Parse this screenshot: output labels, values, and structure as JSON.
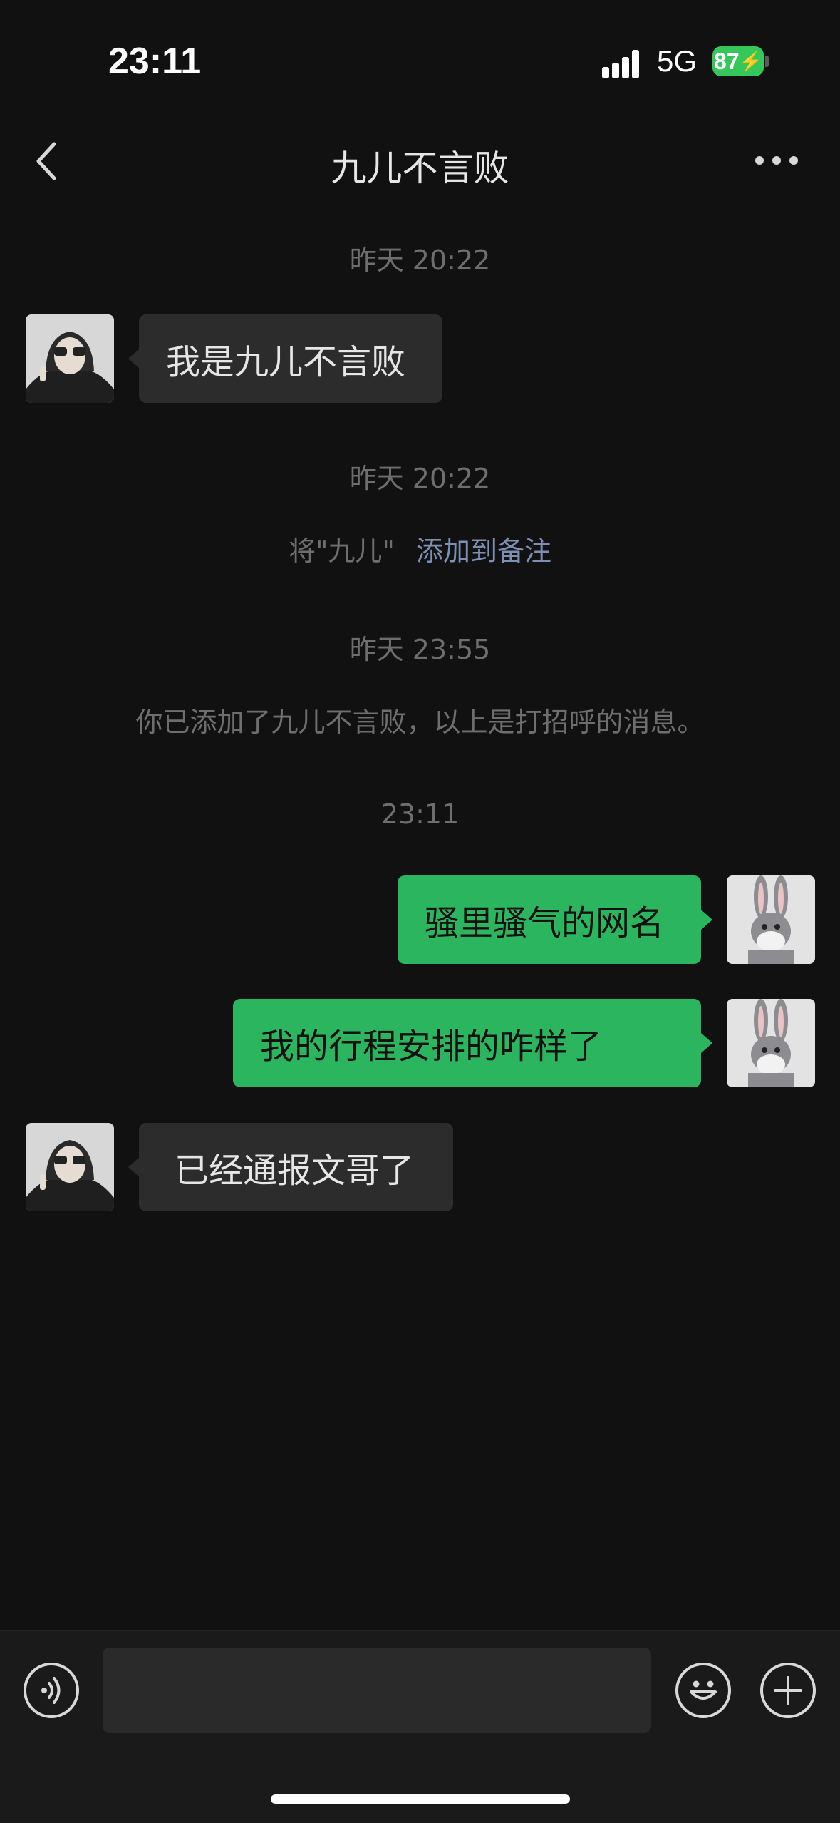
{
  "status_bar": {
    "time": "23:11",
    "network": "5G",
    "battery": "87"
  },
  "nav": {
    "title": "九儿不言败"
  },
  "messages": [
    {
      "type": "time",
      "text": "昨天 20:22"
    },
    {
      "type": "incoming",
      "text": "我是九儿不言败"
    },
    {
      "type": "time",
      "text": "昨天 20:22"
    },
    {
      "type": "remark",
      "prefix": "将\"九儿\"",
      "link": "添加到备注"
    },
    {
      "type": "time",
      "text": "昨天 23:55"
    },
    {
      "type": "system",
      "text": "你已添加了九儿不言败，以上是打招呼的消息。"
    },
    {
      "type": "time",
      "text": "23:11"
    },
    {
      "type": "outgoing",
      "text": "骚里骚气的网名"
    },
    {
      "type": "outgoing",
      "text": "我的行程安排的咋样了"
    },
    {
      "type": "incoming",
      "text": "已经通报文哥了"
    }
  ],
  "input": {
    "value": "",
    "placeholder": ""
  },
  "icons": {
    "back": "chevron-left-icon",
    "more": "more-dots-icon",
    "voice": "voice-icon",
    "emoji": "emoji-icon",
    "plus": "plus-icon"
  },
  "colors": {
    "outgoing_bubble": "#2bb55e",
    "incoming_bubble": "#2c2c2c",
    "link": "#7d90b3",
    "battery": "#35c759"
  }
}
